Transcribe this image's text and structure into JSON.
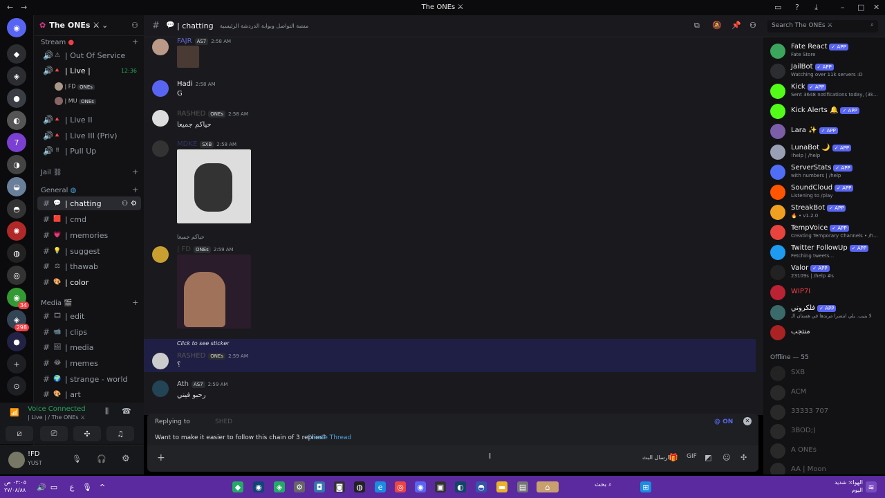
{
  "window": {
    "title": "The ONEs ⚔"
  },
  "server": {
    "name": "The ONEs ⚔"
  },
  "categories": {
    "stream": "Stream",
    "jail": "Jail ⛓",
    "general": "General",
    "media": "Media"
  },
  "channels": [
    {
      "label": "| Out Of Service",
      "emoji": "⚠"
    },
    {
      "label": "| Live |",
      "emoji": "🔺"
    },
    {
      "label": "| Live II",
      "emoji": "🔺"
    },
    {
      "label": "| Live III (Priv)",
      "emoji": "🔺"
    },
    {
      "label": "| Pull Up",
      "emoji": "‼"
    },
    {
      "label": "| chatting",
      "emoji": "💬"
    },
    {
      "label": "| cmd",
      "emoji": "🟥"
    },
    {
      "label": "| memories",
      "emoji": "💗"
    },
    {
      "label": "| suggest",
      "emoji": "💡"
    },
    {
      "label": "| thawab",
      "emoji": "⚖"
    },
    {
      "label": "| color",
      "emoji": "🎨"
    },
    {
      "label": "| edit",
      "emoji": "🎞"
    },
    {
      "label": "| clips",
      "emoji": "📹"
    },
    {
      "label": "| media",
      "emoji": "🖼"
    },
    {
      "label": "| memes",
      "emoji": "😂"
    },
    {
      "label": "| strange - world",
      "emoji": "🌍"
    },
    {
      "label": "| art",
      "emoji": "🎨"
    }
  ],
  "live_timer": "12:36",
  "voice_users": [
    "| FD",
    "| MU"
  ],
  "voice_role": "ONEs",
  "voice": {
    "status": "Voice Connected",
    "location": "| Live | / The ONEs ⚔"
  },
  "user": {
    "name": "!FD",
    "status": "YUST"
  },
  "header": {
    "channel": "| chatting",
    "topic": "منصة التواصل وبوابة الدردشة الرئيسية",
    "search_placeholder": "Search The ONEs ⚔"
  },
  "messages": [
    {
      "user": "FAJR",
      "tag": "AS7",
      "time": "2:58 AM",
      "text": ""
    },
    {
      "user": "Hadi",
      "tag": "",
      "time": "2:58 AM",
      "text": "G"
    },
    {
      "user": "RASHED",
      "tag": "ONEs",
      "time": "2:58 AM",
      "text": "حياكم جميعا"
    },
    {
      "user": "MDKE",
      "tag": "SXB",
      "time": "2:58 AM",
      "text": ""
    },
    {
      "user": "| FD",
      "tag": "ONEs",
      "time": "2:59 AM",
      "text": "",
      "reply": "حياكم جميعا"
    },
    {
      "user": "RASHED",
      "tag": "ONEs",
      "time": "2:59 AM",
      "text": "؟",
      "reply": "Click to see sticker"
    },
    {
      "user": "Ath",
      "tag": "AS7",
      "time": "2:59 AM",
      "text": "رحبو فيني"
    }
  ],
  "reply_bar": {
    "replying_to": "Replying to",
    "target": "SHED",
    "mention_toggle": "@ ON",
    "hint": "Want to make it easier to follow this chain of 3 replies?",
    "create_thread": "Create Thread"
  },
  "composer": {
    "placeholder": "ارسال البث"
  },
  "members": [
    {
      "name": "Fate React",
      "app": true,
      "status": "Fate Store",
      "color": "#3ba55d"
    },
    {
      "name": "JailBot",
      "app": true,
      "status": "Watching over 11k servers :D",
      "color": "#2b2d31"
    },
    {
      "name": "Kick",
      "app": true,
      "status": "Sent 3648 notifications today, (3k...",
      "color": "#53fc18"
    },
    {
      "name": "Kick Alerts 🔔",
      "app": true,
      "status": "",
      "color": "#53fc18"
    },
    {
      "name": "Lara ✨",
      "app": true,
      "status": "",
      "color": "#7b5ea7"
    },
    {
      "name": "LunaBot 🌙",
      "app": true,
      "status": "!help | /help",
      "color": "#9aa0b4"
    },
    {
      "name": "ServerStats",
      "app": true,
      "status": "with numbers | /help",
      "color": "#4f6df5"
    },
    {
      "name": "SoundCloud",
      "app": true,
      "status": "Listening to /play",
      "color": "#ff5500"
    },
    {
      "name": "StreakBot",
      "app": true,
      "status": "🔥 • v1.2.0",
      "color": "#f0a020"
    },
    {
      "name": "TempVoice",
      "app": true,
      "status": "Creating Temporary Channels • /h...",
      "color": "#e8433d"
    },
    {
      "name": "Twitter FollowUp",
      "app": true,
      "status": "Fetching tweets...",
      "color": "#1d9bf0"
    },
    {
      "name": "Valor",
      "app": true,
      "status": "23109s | /help #s",
      "color": "#222"
    },
    {
      "name": "WIP7I",
      "app": false,
      "status": "",
      "color": "#b23"
    },
    {
      "name": "فلكروني",
      "app": true,
      "status": "لا يتيب. يلي انتضرا مرندها في هستان الـ",
      "color": "#3a6a6a"
    },
    {
      "name": "منتجب",
      "app": false,
      "status": "",
      "color": "#a22"
    }
  ],
  "offline_header": "Offline — 55",
  "offline_members": [
    {
      "name": "SXB",
      "color": "#444"
    },
    {
      "name": "ACM",
      "color": "#555"
    },
    {
      "name": "33333 707",
      "color": "#555"
    },
    {
      "name": "3BOD;)",
      "color": "#555"
    },
    {
      "name": "A ONEs",
      "color": "#555"
    },
    {
      "name": "AA | Moon",
      "color": "#555"
    }
  ],
  "taskbar": {
    "search": "بحث",
    "time": "٠٣:٠٥ ص",
    "date": "٢٧/٠٨/٨٨",
    "weather_label": "الهواء: شديد",
    "weather_sub": "اليوم"
  }
}
